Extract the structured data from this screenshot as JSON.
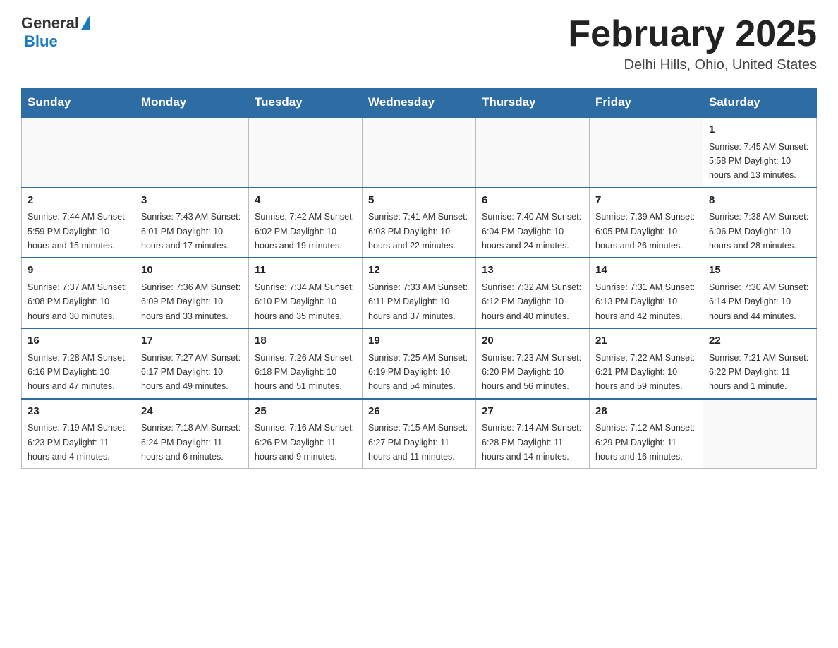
{
  "header": {
    "logo_general": "General",
    "logo_blue": "Blue",
    "month_title": "February 2025",
    "location": "Delhi Hills, Ohio, United States"
  },
  "days_of_week": [
    "Sunday",
    "Monday",
    "Tuesday",
    "Wednesday",
    "Thursday",
    "Friday",
    "Saturday"
  ],
  "weeks": [
    [
      {
        "day": "",
        "info": ""
      },
      {
        "day": "",
        "info": ""
      },
      {
        "day": "",
        "info": ""
      },
      {
        "day": "",
        "info": ""
      },
      {
        "day": "",
        "info": ""
      },
      {
        "day": "",
        "info": ""
      },
      {
        "day": "1",
        "info": "Sunrise: 7:45 AM\nSunset: 5:58 PM\nDaylight: 10 hours and 13 minutes."
      }
    ],
    [
      {
        "day": "2",
        "info": "Sunrise: 7:44 AM\nSunset: 5:59 PM\nDaylight: 10 hours and 15 minutes."
      },
      {
        "day": "3",
        "info": "Sunrise: 7:43 AM\nSunset: 6:01 PM\nDaylight: 10 hours and 17 minutes."
      },
      {
        "day": "4",
        "info": "Sunrise: 7:42 AM\nSunset: 6:02 PM\nDaylight: 10 hours and 19 minutes."
      },
      {
        "day": "5",
        "info": "Sunrise: 7:41 AM\nSunset: 6:03 PM\nDaylight: 10 hours and 22 minutes."
      },
      {
        "day": "6",
        "info": "Sunrise: 7:40 AM\nSunset: 6:04 PM\nDaylight: 10 hours and 24 minutes."
      },
      {
        "day": "7",
        "info": "Sunrise: 7:39 AM\nSunset: 6:05 PM\nDaylight: 10 hours and 26 minutes."
      },
      {
        "day": "8",
        "info": "Sunrise: 7:38 AM\nSunset: 6:06 PM\nDaylight: 10 hours and 28 minutes."
      }
    ],
    [
      {
        "day": "9",
        "info": "Sunrise: 7:37 AM\nSunset: 6:08 PM\nDaylight: 10 hours and 30 minutes."
      },
      {
        "day": "10",
        "info": "Sunrise: 7:36 AM\nSunset: 6:09 PM\nDaylight: 10 hours and 33 minutes."
      },
      {
        "day": "11",
        "info": "Sunrise: 7:34 AM\nSunset: 6:10 PM\nDaylight: 10 hours and 35 minutes."
      },
      {
        "day": "12",
        "info": "Sunrise: 7:33 AM\nSunset: 6:11 PM\nDaylight: 10 hours and 37 minutes."
      },
      {
        "day": "13",
        "info": "Sunrise: 7:32 AM\nSunset: 6:12 PM\nDaylight: 10 hours and 40 minutes."
      },
      {
        "day": "14",
        "info": "Sunrise: 7:31 AM\nSunset: 6:13 PM\nDaylight: 10 hours and 42 minutes."
      },
      {
        "day": "15",
        "info": "Sunrise: 7:30 AM\nSunset: 6:14 PM\nDaylight: 10 hours and 44 minutes."
      }
    ],
    [
      {
        "day": "16",
        "info": "Sunrise: 7:28 AM\nSunset: 6:16 PM\nDaylight: 10 hours and 47 minutes."
      },
      {
        "day": "17",
        "info": "Sunrise: 7:27 AM\nSunset: 6:17 PM\nDaylight: 10 hours and 49 minutes."
      },
      {
        "day": "18",
        "info": "Sunrise: 7:26 AM\nSunset: 6:18 PM\nDaylight: 10 hours and 51 minutes."
      },
      {
        "day": "19",
        "info": "Sunrise: 7:25 AM\nSunset: 6:19 PM\nDaylight: 10 hours and 54 minutes."
      },
      {
        "day": "20",
        "info": "Sunrise: 7:23 AM\nSunset: 6:20 PM\nDaylight: 10 hours and 56 minutes."
      },
      {
        "day": "21",
        "info": "Sunrise: 7:22 AM\nSunset: 6:21 PM\nDaylight: 10 hours and 59 minutes."
      },
      {
        "day": "22",
        "info": "Sunrise: 7:21 AM\nSunset: 6:22 PM\nDaylight: 11 hours and 1 minute."
      }
    ],
    [
      {
        "day": "23",
        "info": "Sunrise: 7:19 AM\nSunset: 6:23 PM\nDaylight: 11 hours and 4 minutes."
      },
      {
        "day": "24",
        "info": "Sunrise: 7:18 AM\nSunset: 6:24 PM\nDaylight: 11 hours and 6 minutes."
      },
      {
        "day": "25",
        "info": "Sunrise: 7:16 AM\nSunset: 6:26 PM\nDaylight: 11 hours and 9 minutes."
      },
      {
        "day": "26",
        "info": "Sunrise: 7:15 AM\nSunset: 6:27 PM\nDaylight: 11 hours and 11 minutes."
      },
      {
        "day": "27",
        "info": "Sunrise: 7:14 AM\nSunset: 6:28 PM\nDaylight: 11 hours and 14 minutes."
      },
      {
        "day": "28",
        "info": "Sunrise: 7:12 AM\nSunset: 6:29 PM\nDaylight: 11 hours and 16 minutes."
      },
      {
        "day": "",
        "info": ""
      }
    ]
  ]
}
